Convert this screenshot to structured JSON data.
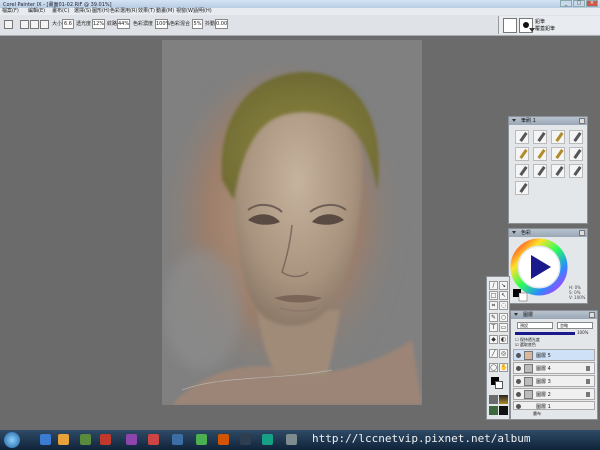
{
  "window": {
    "title": "Corel Painter IX - [畫面01-02.RIF @ 39.01%]",
    "minimize": "_",
    "maximize": "□",
    "close": "×"
  },
  "menu": [
    "檔案(F)",
    "編輯(E)",
    "畫布(C)",
    "選擇(S)",
    "圖形(H)",
    "色彩選用(R)",
    "效果(T)",
    "動畫(M)",
    "視窗(W)",
    "說明(H)"
  ],
  "toolbar": {
    "size_label": "大小",
    "size_value": "6.6",
    "opacity_label": "透光度",
    "opacity_value": "12%",
    "grain_label": "紋路",
    "grain_value": "44%",
    "resat_label": "色彩濃度",
    "resat_value": "100%",
    "bleed_label": "色彩混合",
    "bleed_value": "5%",
    "jitter_label": "抖動",
    "jitter_value": "0.00"
  },
  "brush_selector": {
    "category": "鉛筆",
    "variant": "覆蓋鉛筆"
  },
  "brushes_panel": {
    "title": "筆刷 1"
  },
  "colors_panel": {
    "title": "色彩",
    "readout": [
      "H: 0%",
      "S: 0%",
      "V: 100%"
    ]
  },
  "layers_panel": {
    "title": "圖層",
    "composite_method": "預設",
    "composite_depth": "忽略",
    "opacity_value": "100%",
    "option_preserve": "保持透光度",
    "option_pick_up": "選取底色",
    "layers": [
      {
        "name": "圖層 5",
        "selected": true
      },
      {
        "name": "圖層 4",
        "selected": false
      },
      {
        "name": "圖層 3",
        "selected": false
      },
      {
        "name": "圖層 2",
        "selected": false
      },
      {
        "name": "圖層 1",
        "selected": false
      },
      {
        "name": "畫布",
        "selected": false
      }
    ]
  },
  "watermark": "http://lccnetvip.pixnet.net/album",
  "colors": {
    "accent": "#1a1a8c",
    "taskbar": "#1b334d",
    "canvas_bg": "#808080"
  }
}
